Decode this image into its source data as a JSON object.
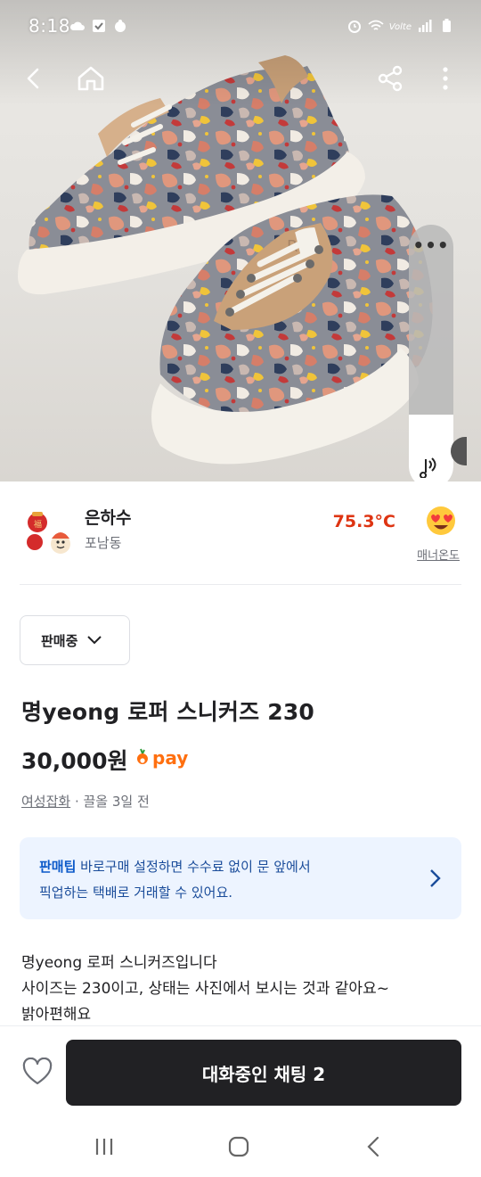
{
  "status_bar": {
    "time": "8:18",
    "network_label": "Volte",
    "icons_left": [
      "cloud-icon",
      "checkbox-icon",
      "notification-icon"
    ],
    "icons_right": [
      "alarm-icon",
      "wifi-icon",
      "signal-icon",
      "battery-icon"
    ]
  },
  "top_nav": {
    "icons": [
      "back-icon",
      "home-icon",
      "share-icon",
      "more-vertical-icon"
    ]
  },
  "audio_control": {
    "menu_icon": "more-horizontal-icon",
    "speaker_icon": "volume-icon",
    "volume_level": 0.28
  },
  "seller": {
    "nickname": "은하수",
    "region": "포남동",
    "manner_temperature": "75.3°C",
    "manner_label": "매너온도",
    "temperature_emoji": "heart-eyes-emoji"
  },
  "product": {
    "status_label": "판매중",
    "title": "명yeong 로퍼 스니커즈 230",
    "price": "30,000원",
    "pay_label": "pay",
    "category": "여성잡화",
    "time_info": " · 끌올 3일 전",
    "description_lines": [
      "명yeong 로퍼 스니커즈입니다",
      "사이즈는 230이고, 상태는 사진에서 보시는 것과 같아요~",
      "밝아편해요"
    ]
  },
  "tip": {
    "prefix": "판매팁",
    "line1": " 바로구매 설정하면 수수료 없이 문 앞에서",
    "line2": "픽업하는 택배로 거래할 수 있어요."
  },
  "bottom_bar": {
    "chat_button_label": "대화중인 채팅 2",
    "like_icon": "heart-icon"
  },
  "system_nav": {
    "icons": [
      "recent-apps-icon",
      "home-button-icon",
      "back-button-icon"
    ]
  },
  "colors": {
    "brand_orange": "#ff6f0f",
    "temperature_red": "#de3412",
    "tip_background": "#edf4ff",
    "chat_button": "#212124"
  }
}
